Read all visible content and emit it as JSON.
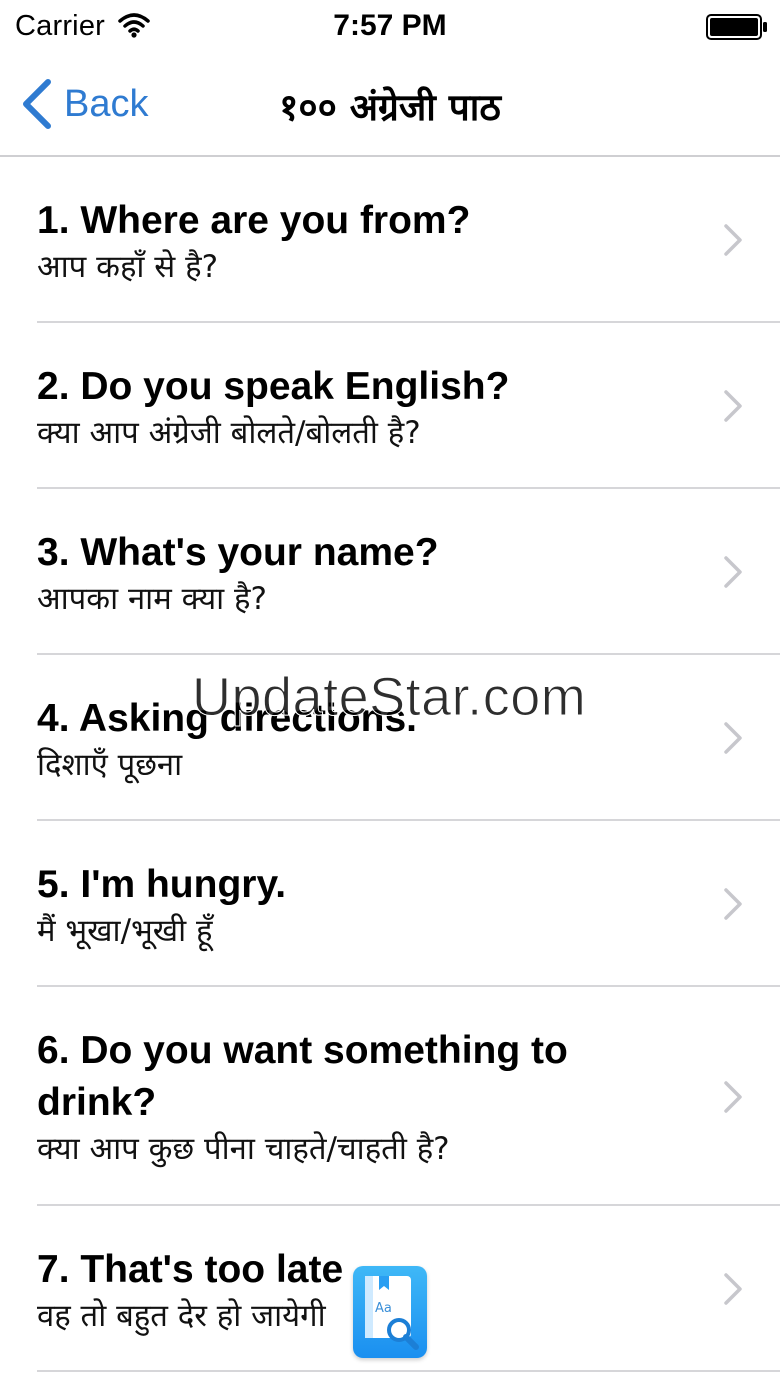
{
  "status_bar": {
    "carrier": "Carrier",
    "time": "7:57 PM",
    "wifi_icon": "wifi-icon",
    "battery_icon": "battery-icon"
  },
  "nav": {
    "back_label": "Back",
    "title": "१०० अंग्रेजी पाठ",
    "accent_color": "#2f7bd1"
  },
  "lessons": [
    {
      "title": "1. Where are you from?",
      "subtitle": "आप कहाँ से है?"
    },
    {
      "title": "2. Do you speak English?",
      "subtitle": "क्या आप अंग्रेजी बोलते/बोलती है?"
    },
    {
      "title": "3. What's your name?",
      "subtitle": "आपका नाम क्या है?"
    },
    {
      "title": "4. Asking directions.",
      "subtitle": "दिशाएँ पूछना"
    },
    {
      "title": "5. I'm hungry.",
      "subtitle": "मैं भूखा/भूखी हूँ"
    },
    {
      "title": "6. Do you want something to drink?",
      "subtitle": "क्या आप कुछ पीना चाहते/चाहती है?"
    },
    {
      "title": "7. That's too late",
      "subtitle": "वह तो बहुत देर हो जायेगी"
    }
  ],
  "watermark": "UpdateStar.com",
  "overlay_icon": "dictionary-app-icon"
}
